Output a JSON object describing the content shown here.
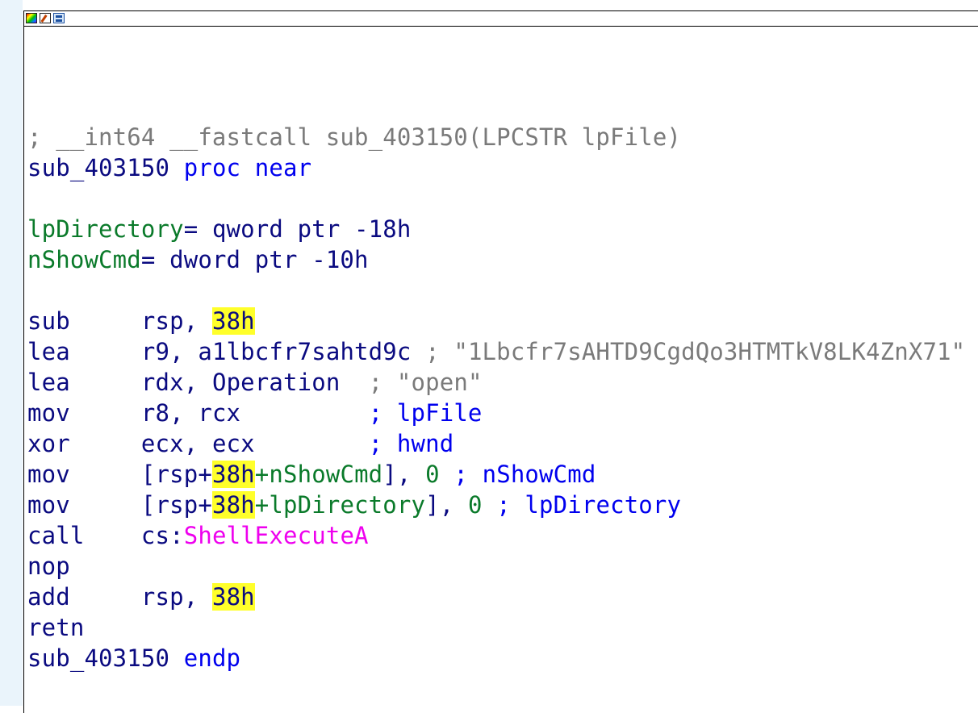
{
  "code": {
    "comment_signature": "; __int64 __fastcall sub_403150(LPCSTR lpFile)",
    "proc_name": "sub_403150",
    "proc_keyword": " proc near",
    "var1_name": "lpDirectory",
    "var1_def": "= qword ptr -18h",
    "var2_name": "nShowCmd",
    "var2_def": "= dword ptr -10h",
    "instructions": [
      {
        "mnemonic": "sub     ",
        "op1": "rsp, ",
        "hl": "38h"
      },
      {
        "mnemonic": "lea     ",
        "op1": "r9, ",
        "op_link": "a1lbcfr7sahtd9c",
        "comment": " ; \"1Lbcfr7sAHTD9CgdQo3HTMTkV8LK4ZnX71\""
      },
      {
        "mnemonic": "lea     ",
        "op1": "rdx, ",
        "op_link": "Operation",
        "comment": "  ; \"open\""
      },
      {
        "mnemonic": "mov     ",
        "op1": "r8, rcx         ",
        "comment": "; lpFile"
      },
      {
        "mnemonic": "xor     ",
        "op1": "ecx, ecx        ",
        "comment": "; hwnd"
      },
      {
        "mnemonic": "mov     ",
        "pre": "[rsp+",
        "hl": "38h",
        "post_var": "+nShowCmd",
        "post": "], ",
        "imm": "0",
        "comment": " ; nShowCmd"
      },
      {
        "mnemonic": "mov     ",
        "pre": "[rsp+",
        "hl": "38h",
        "post_var": "+lpDirectory",
        "post": "], ",
        "imm": "0",
        "comment": " ; lpDirectory"
      },
      {
        "mnemonic": "call    ",
        "op1": "cs:",
        "import": "ShellExecuteA"
      },
      {
        "mnemonic": "nop"
      },
      {
        "mnemonic": "add     ",
        "op1": "rsp, ",
        "hl": "38h"
      },
      {
        "mnemonic": "retn"
      }
    ],
    "endp_name": "sub_403150",
    "endp_keyword": " endp"
  },
  "icons": [
    "color-palette-icon",
    "edit-icon",
    "graph-view-icon"
  ]
}
